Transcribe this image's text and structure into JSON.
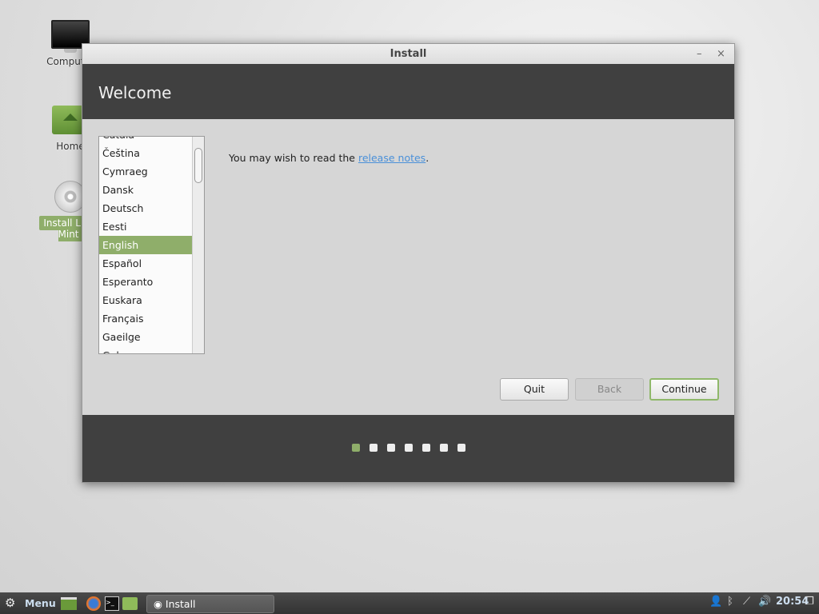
{
  "desktop": {
    "icons": [
      {
        "label": "Computer"
      },
      {
        "label": "Home"
      },
      {
        "label": "Install Linux Mint"
      }
    ]
  },
  "window": {
    "title": "Install",
    "minimize": "–",
    "close": "×",
    "header": "Welcome",
    "languages": [
      "Català",
      "Čeština",
      "Cymraeg",
      "Dansk",
      "Deutsch",
      "Eesti",
      "English",
      "Español",
      "Esperanto",
      "Euskara",
      "Français",
      "Gaeilge",
      "Galego"
    ],
    "selected_language": "English",
    "message_prefix": "You may wish to read the ",
    "message_link": "release notes",
    "message_suffix": ".",
    "buttons": {
      "quit": "Quit",
      "back": "Back",
      "continue": "Continue"
    },
    "progress": {
      "current_step": 1,
      "total_steps": 7
    }
  },
  "panel": {
    "menu_label": "Menu",
    "task_label": "Install",
    "clock": "20:54"
  },
  "colors": {
    "accent": "#8fae6a",
    "dark": "#404040"
  }
}
